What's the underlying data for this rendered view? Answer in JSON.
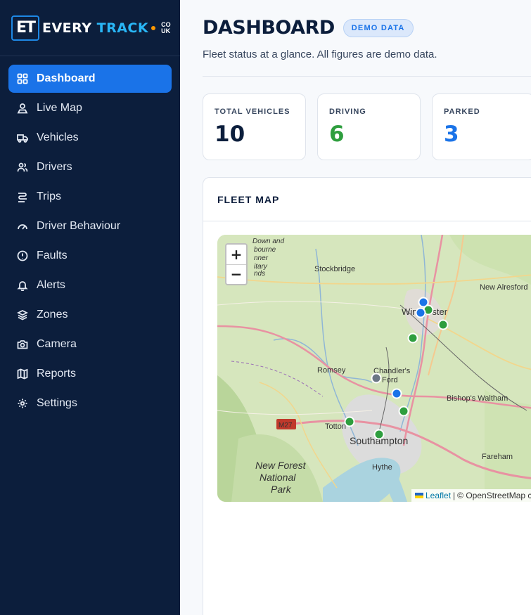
{
  "brand": {
    "mark": "ET",
    "name_a": "EVERY ",
    "name_b": "TRACK",
    "tld_top": "CO",
    "tld_bottom": "UK"
  },
  "nav": [
    {
      "label": "Dashboard",
      "icon": "grid-icon",
      "active": true
    },
    {
      "label": "Live Map",
      "icon": "map-pin-user-icon"
    },
    {
      "label": "Vehicles",
      "icon": "truck-icon"
    },
    {
      "label": "Drivers",
      "icon": "users-icon"
    },
    {
      "label": "Trips",
      "icon": "route-icon"
    },
    {
      "label": "Driver Behaviour",
      "icon": "gauge-icon"
    },
    {
      "label": "Faults",
      "icon": "alert-circle-icon"
    },
    {
      "label": "Alerts",
      "icon": "bell-icon"
    },
    {
      "label": "Zones",
      "icon": "layers-icon"
    },
    {
      "label": "Camera",
      "icon": "camera-icon"
    },
    {
      "label": "Reports",
      "icon": "book-map-icon"
    },
    {
      "label": "Settings",
      "icon": "gear-icon"
    }
  ],
  "header": {
    "title": "DASHBOARD",
    "badge": "DEMO DATA",
    "subtitle": "Fleet status at a glance. All figures are demo data."
  },
  "stats": [
    {
      "label": "TOTAL VEHICLES",
      "value": "10",
      "color": "#0c1e3c"
    },
    {
      "label": "DRIVING",
      "value": "6",
      "color": "#2e9e3e"
    },
    {
      "label": "PARKED",
      "value": "3",
      "color": "#1a73e8"
    }
  ],
  "map_card": {
    "title": "FLEET MAP",
    "zoom_in": "+",
    "zoom_out": "−",
    "attribution_leaflet": "Leaflet",
    "attribution_sep": "|",
    "attribution_osm": "© OpenStreetMap c",
    "places": [
      "Stockbridge",
      "New Alresford",
      "Winchester",
      "Romsey",
      "Chandler's",
      "Ford",
      "Bishop's Waltham",
      "Totton",
      "Southampton",
      "Hythe",
      "Fareham",
      "New Forest",
      "National",
      "Park",
      "M27",
      "Down and",
      "bourne",
      "nner",
      "itary",
      "nds"
    ],
    "marker_colors": {
      "driving": "#2e9e3e",
      "parked": "#1a73e8",
      "offline": "#6b7785"
    }
  }
}
